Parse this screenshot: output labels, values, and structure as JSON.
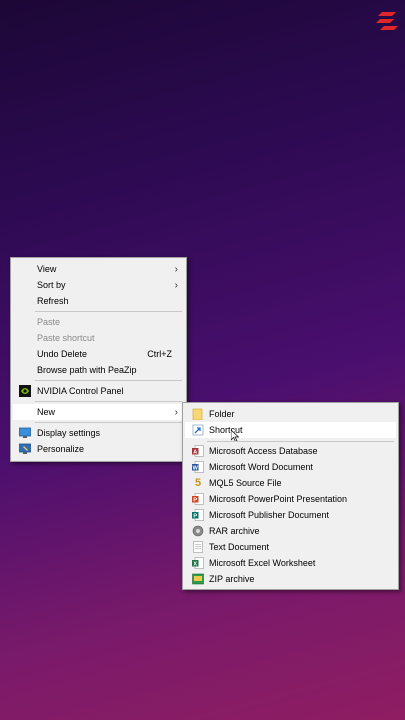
{
  "main_menu": {
    "items": [
      {
        "label": "View"
      },
      {
        "label": "Sort by"
      },
      {
        "label": "Refresh"
      },
      {
        "label": "Paste"
      },
      {
        "label": "Paste shortcut"
      },
      {
        "label": "Undo Delete",
        "shortcut": "Ctrl+Z"
      },
      {
        "label": "Browse path with PeaZip"
      },
      {
        "label": "NVIDIA Control Panel"
      },
      {
        "label": "New"
      },
      {
        "label": "Display settings"
      },
      {
        "label": "Personalize"
      }
    ]
  },
  "new_submenu": {
    "items": [
      {
        "label": "Folder"
      },
      {
        "label": "Shortcut"
      },
      {
        "label": "Microsoft Access Database"
      },
      {
        "label": "Microsoft Word Document"
      },
      {
        "label": "MQL5 Source File",
        "icon_text": "5"
      },
      {
        "label": "Microsoft PowerPoint Presentation"
      },
      {
        "label": "Microsoft Publisher Document"
      },
      {
        "label": "RAR archive"
      },
      {
        "label": "Text Document"
      },
      {
        "label": "Microsoft Excel Worksheet"
      },
      {
        "label": "ZIP archive"
      }
    ]
  },
  "colors": {
    "menu_bg": "#f0f0f0",
    "highlight_bg": "#ffffff",
    "disabled_text": "#8a8a8a",
    "logo_red": "#e0262b"
  }
}
